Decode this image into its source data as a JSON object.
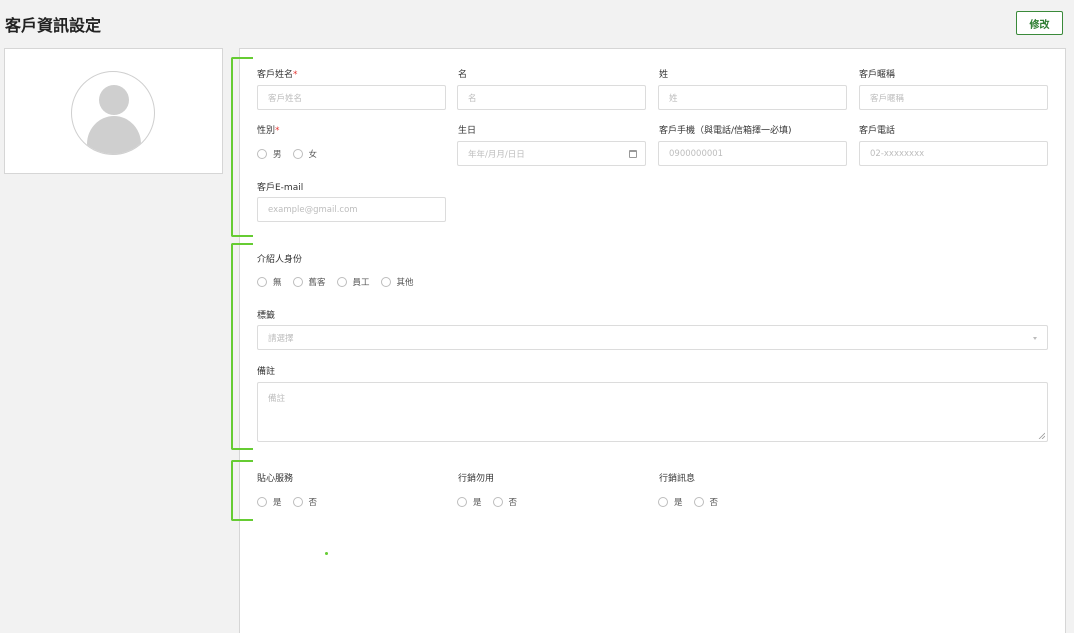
{
  "header": {
    "title": "客戶資訊設定",
    "edit_label": "修改"
  },
  "form": {
    "name_label": "客戶姓名",
    "required_mark": "*",
    "name_placeholder": "客戶姓名",
    "first_label": "名",
    "first_placeholder": "名",
    "last_label": "姓",
    "last_placeholder": "姓",
    "nickname_label": "客戶暱稱",
    "nickname_placeholder": "客戶暱稱",
    "gender_label": "性別",
    "gender_options": [
      "男",
      "女"
    ],
    "birthday_label": "生日",
    "birthday_placeholder": "年年/月月/日日",
    "mobile_label": "客戶手機（與電話/信箱擇一必填)",
    "mobile_placeholder": "0900000001",
    "phone_label": "客戶電話",
    "phone_placeholder": "02-xxxxxxxx",
    "email_label": "客戶E-mail",
    "email_placeholder": "example@gmail.com",
    "referrer_label": "介紹人身份",
    "referrer_options": [
      "無",
      "舊客",
      "員工",
      "其他"
    ],
    "tag_label": "標籤",
    "tag_placeholder": "請選擇",
    "note_label": "備註",
    "note_placeholder": "備註",
    "care_label": "貼心服務",
    "care_options": [
      "是",
      "否"
    ],
    "marketing_dnd_label": "行銷勿用",
    "marketing_dnd_options": [
      "是",
      "否"
    ],
    "marketing_msg_label": "行銷訊息",
    "marketing_msg_options": [
      "是",
      "否"
    ]
  },
  "colors": {
    "annotation": "#66cc33",
    "accent": "#2e7d32",
    "required": "#e53935"
  }
}
